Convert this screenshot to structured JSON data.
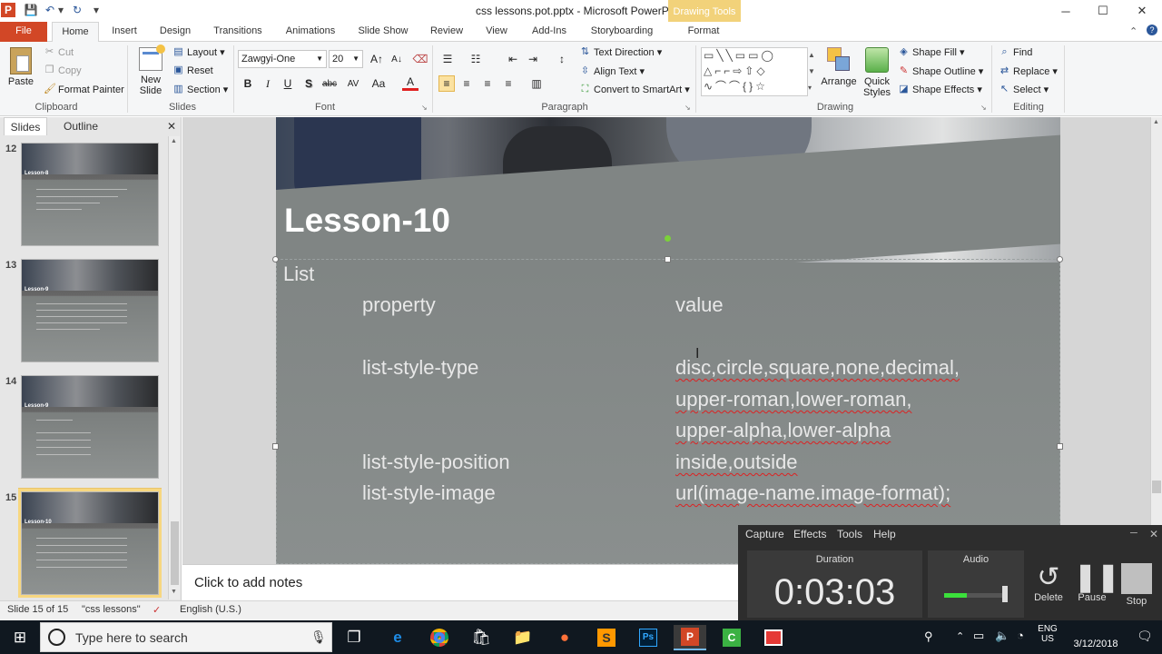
{
  "window": {
    "title": "css lessons.pot.pptx - Microsoft PowerPoint",
    "contextual_tab_group": "Drawing Tools",
    "minimize": "─",
    "maximize": "☐",
    "close": "✕",
    "qat": {
      "app": "P",
      "save": "💾",
      "undo": "↶",
      "undo_drop": "▾",
      "redo": "↻",
      "customize": "▾"
    }
  },
  "tabs": [
    "File",
    "Home",
    "Insert",
    "Design",
    "Transitions",
    "Animations",
    "Slide Show",
    "Review",
    "View",
    "Add-Ins",
    "Storyboarding",
    "Format"
  ],
  "ribbon": {
    "clipboard": {
      "group": "Clipboard",
      "paste": "Paste",
      "cut": "Cut",
      "copy": "Copy",
      "format_painter": "Format Painter"
    },
    "slides": {
      "group": "Slides",
      "new_slide": "New Slide",
      "new_slide2": "▾",
      "layout": "Layout ▾",
      "reset": "Reset",
      "section": "Section ▾"
    },
    "font": {
      "group": "Font",
      "font_name": "Zawgyi-One",
      "font_size": "20",
      "grow": "A↑",
      "shrink": "A↓",
      "clear": "⌫",
      "bold": "B",
      "italic": "I",
      "underline": "U",
      "shadow": "S",
      "strike": "abc",
      "spacing": "AV",
      "case": "Aa",
      "color": "A"
    },
    "paragraph": {
      "group": "Paragraph",
      "text_direction": "Text Direction ▾",
      "align_text": "Align Text ▾",
      "convert": "Convert to SmartArt ▾"
    },
    "drawing": {
      "group": "Drawing",
      "arrange": "Arrange",
      "quick_styles": "Quick Styles",
      "shape_fill": "Shape Fill ▾",
      "shape_outline": "Shape Outline ▾",
      "shape_effects": "Shape Effects ▾"
    },
    "editing": {
      "group": "Editing",
      "find": "Find",
      "replace": "Replace ▾",
      "select": "Select ▾"
    }
  },
  "left_pane": {
    "tab_slides": "Slides",
    "tab_outline": "Outline",
    "close": "✕",
    "thumbnails": [
      {
        "num": "12",
        "title": "Lesson-8"
      },
      {
        "num": "13",
        "title": "Lesson-9"
      },
      {
        "num": "14",
        "title": "Lesson-9"
      },
      {
        "num": "15",
        "title": "Lesson-10"
      }
    ]
  },
  "slide": {
    "title": "Lesson-10",
    "heading": "List",
    "col_property": "property",
    "col_value": "value",
    "rows": [
      {
        "property": "list-style-type",
        "value_lines": [
          "disc,circle,square,none,decimal,",
          "upper-roman,lower-roman,",
          "upper-alpha,lower-alpha"
        ]
      },
      {
        "property": "list-style-position",
        "value_lines": [
          "inside,outside"
        ]
      },
      {
        "property": "list-style-image",
        "value_lines": [
          "url(image-name.image-format);"
        ]
      }
    ]
  },
  "notes": {
    "placeholder": "Click to add notes"
  },
  "status": {
    "slide": "Slide 15 of 15",
    "theme": "\"css lessons\"",
    "language": "English (U.S.)"
  },
  "recorder": {
    "menu": [
      "Capture",
      "Effects",
      "Tools",
      "Help"
    ],
    "duration_label": "Duration",
    "timer": "0:03:03",
    "audio_label": "Audio",
    "audio_level": 0.35,
    "delete": "Delete",
    "pause": "Pause",
    "stop": "Stop"
  },
  "taskbar": {
    "search_placeholder": "Type here to search",
    "tray_lang": "ENG",
    "tray_region": "US",
    "date": "3/12/2018"
  },
  "colors": {
    "file_tab": "#d24726",
    "drawing_tools": "#f2d27a",
    "slide_bg": "#808584",
    "selected_thumb": "#f7d780"
  }
}
